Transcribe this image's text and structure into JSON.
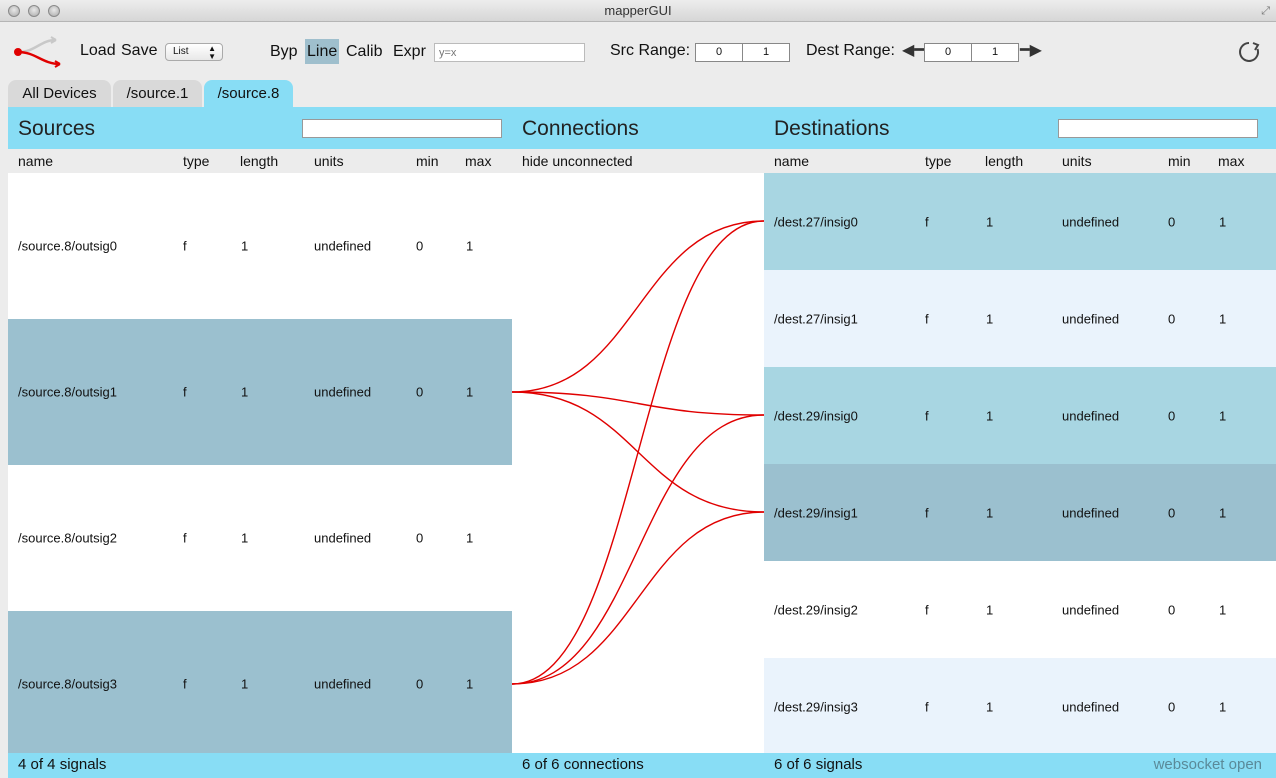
{
  "window": {
    "title": "mapperGUI"
  },
  "toolbar": {
    "load_label": "Load",
    "save_label": "Save",
    "format_select": "List",
    "modes": [
      "Byp",
      "Line",
      "Calib",
      "Expr"
    ],
    "active_mode": "Line",
    "expr_placeholder": "y=x",
    "src_range_label": "Src Range:",
    "src_range": [
      "0",
      "1"
    ],
    "dest_range_label": "Dest Range:",
    "dest_range": [
      "0",
      "1"
    ]
  },
  "tabs": [
    "All Devices",
    "/source.1",
    "/source.8"
  ],
  "active_tab": "/source.8",
  "sources": {
    "title": "Sources",
    "columns": [
      "name",
      "type",
      "length",
      "units",
      "min",
      "max"
    ],
    "rows": [
      {
        "name": "/source.8/outsig0",
        "type": "f",
        "length": "1",
        "units": "undefined",
        "min": "0",
        "max": "1",
        "highlighted": false
      },
      {
        "name": "/source.8/outsig1",
        "type": "f",
        "length": "1",
        "units": "undefined",
        "min": "0",
        "max": "1",
        "highlighted": true
      },
      {
        "name": "/source.8/outsig2",
        "type": "f",
        "length": "1",
        "units": "undefined",
        "min": "0",
        "max": "1",
        "highlighted": false
      },
      {
        "name": "/source.8/outsig3",
        "type": "f",
        "length": "1",
        "units": "undefined",
        "min": "0",
        "max": "1",
        "highlighted": true
      }
    ],
    "footer": "4 of 4 signals"
  },
  "connections": {
    "title": "Connections",
    "subheader": "hide unconnected",
    "footer": "6 of 6 connections",
    "line_color": "#e00000",
    "links": [
      {
        "src": 1,
        "dst": 0
      },
      {
        "src": 1,
        "dst": 2
      },
      {
        "src": 1,
        "dst": 3
      },
      {
        "src": 3,
        "dst": 0
      },
      {
        "src": 3,
        "dst": 2
      },
      {
        "src": 3,
        "dst": 3
      }
    ]
  },
  "destinations": {
    "title": "Destinations",
    "columns": [
      "name",
      "type",
      "length",
      "units",
      "min",
      "max"
    ],
    "rows": [
      {
        "name": "/dest.27/insig0",
        "type": "f",
        "length": "1",
        "units": "undefined",
        "min": "0",
        "max": "1",
        "bg": "#a8d6e2"
      },
      {
        "name": "/dest.27/insig1",
        "type": "f",
        "length": "1",
        "units": "undefined",
        "min": "0",
        "max": "1",
        "bg": "#eaf3fc"
      },
      {
        "name": "/dest.29/insig0",
        "type": "f",
        "length": "1",
        "units": "undefined",
        "min": "0",
        "max": "1",
        "bg": "#a8d6e2"
      },
      {
        "name": "/dest.29/insig1",
        "type": "f",
        "length": "1",
        "units": "undefined",
        "min": "0",
        "max": "1",
        "bg": "#9bc0cf"
      },
      {
        "name": "/dest.29/insig2",
        "type": "f",
        "length": "1",
        "units": "undefined",
        "min": "0",
        "max": "1",
        "bg": "#ffffff"
      },
      {
        "name": "/dest.29/insig3",
        "type": "f",
        "length": "1",
        "units": "undefined",
        "min": "0",
        "max": "1",
        "bg": "#eaf3fc"
      }
    ],
    "footer": "6 of 6 signals"
  },
  "status": "websocket open",
  "colors": {
    "accent": "#88ddf5",
    "highlight": "#9bc0cf",
    "active_mode": "#9fbfcd"
  }
}
